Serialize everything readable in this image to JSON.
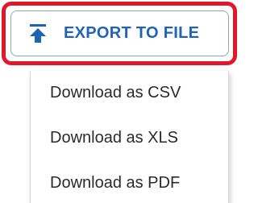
{
  "export_button": {
    "label": "EXPORT TO FILE",
    "icon": "upload-icon",
    "color": "#1f64b4"
  },
  "highlight": {
    "color": "#e0192a"
  },
  "menu": {
    "items": [
      {
        "label": "Download as CSV"
      },
      {
        "label": "Download as XLS"
      },
      {
        "label": "Download as PDF"
      }
    ]
  }
}
